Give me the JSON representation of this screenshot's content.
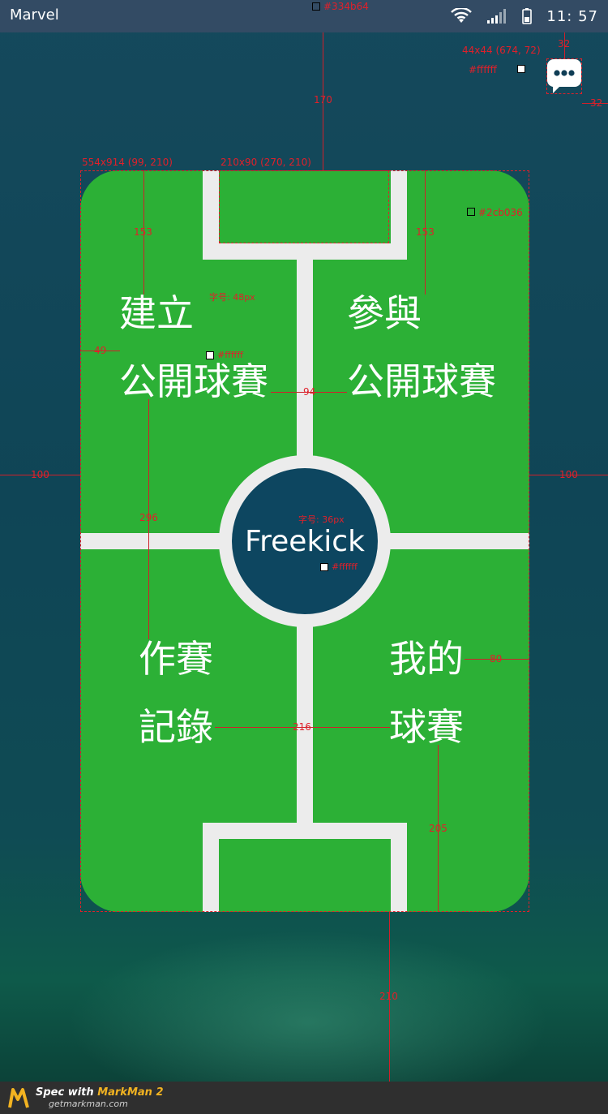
{
  "status_bar": {
    "app_name": "Marvel",
    "time": "11: 57"
  },
  "chat_button": {
    "icon": "chat-bubble-icon"
  },
  "field": {
    "center_label": "Freekick",
    "top_left": {
      "line1": "建立",
      "line2": "公開球賽"
    },
    "top_right": {
      "line1": "參與",
      "line2": "公開球賽"
    },
    "bottom_left": {
      "line1": "作賽",
      "line2": "記錄"
    },
    "bottom_right": {
      "line1": "我的",
      "line2": "球賽"
    }
  },
  "colors": {
    "status_bar": "#334b64",
    "field": "#2cb036",
    "text": "#ffffff",
    "center_disc": "#0d4660"
  },
  "annotations": {
    "status_color": "#334b64",
    "chat_size": "44x44 (674, 72)",
    "chat_color": "#ffffff",
    "chat_top": "32",
    "chat_right": "32",
    "gap_top": "170",
    "field_size": "554x914 (99, 210)",
    "goal_size": "210x90 (270, 210)",
    "field_color": "#2cb036",
    "top_left_gap": "153",
    "top_right_gap": "153",
    "font_size_48": "字号: 48px",
    "text_color_1": "#ffffff",
    "left_margin_text": "49",
    "gap_middle": "94",
    "margin_left": "100",
    "margin_right": "100",
    "font_size_36": "字号: 36px",
    "center_text_color": "#ffffff",
    "vertical_296": "296",
    "right_80": "80",
    "middle_216": "216",
    "bottom_205": "205",
    "bottom_210": "210"
  },
  "footer": {
    "prefix": "Spec with ",
    "brand": "MarkMan 2",
    "url": "getmarkman.com"
  }
}
